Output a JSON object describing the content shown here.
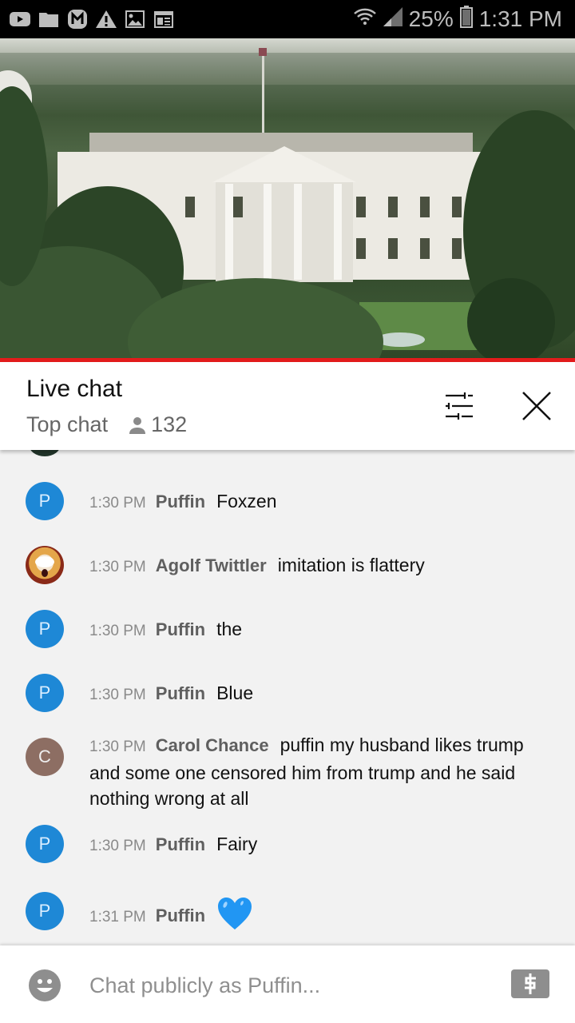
{
  "status_bar": {
    "notification_icons": [
      "youtube-icon",
      "folder-icon",
      "m-app-icon",
      "warning-icon",
      "image-icon",
      "news-icon"
    ],
    "battery_percent": "25%",
    "time": "1:31 PM",
    "wifi": "wifi-icon",
    "signal": "signal-icon"
  },
  "video": {
    "description": "White House live camera feed",
    "progress_color": "#e31b1b"
  },
  "chat_header": {
    "title": "Live chat",
    "mode": "Top chat",
    "viewer_count": "132",
    "filter_icon": "tune-icon",
    "close_icon": "close-icon"
  },
  "messages": [
    {
      "avatar_letter": "P",
      "avatar_color": "#1e88d6",
      "time": "1:30 PM",
      "author": "Puffin",
      "text": "Foxzen"
    },
    {
      "avatar_letter": "",
      "avatar_color": "#c8a05a",
      "avatar_type": "image",
      "time": "1:30 PM",
      "author": "Agolf Twittler",
      "text": "imitation is flattery"
    },
    {
      "avatar_letter": "P",
      "avatar_color": "#1e88d6",
      "time": "1:30 PM",
      "author": "Puffin",
      "text": "the"
    },
    {
      "avatar_letter": "P",
      "avatar_color": "#1e88d6",
      "time": "1:30 PM",
      "author": "Puffin",
      "text": "Blue"
    },
    {
      "avatar_letter": "C",
      "avatar_color": "#8d6e63",
      "time": "1:30 PM",
      "author": "Carol Chance",
      "text": "puffin my husband likes trump and some one censored him from trump and he said nothing wrong at all"
    },
    {
      "avatar_letter": "P",
      "avatar_color": "#1e88d6",
      "time": "1:30 PM",
      "author": "Puffin",
      "text": "Fairy"
    },
    {
      "avatar_letter": "P",
      "avatar_color": "#1e88d6",
      "time": "1:31 PM",
      "author": "Puffin",
      "text": "",
      "emoji": "blue-heart"
    }
  ],
  "input": {
    "placeholder": "Chat publicly as Puffin...",
    "value": "",
    "emoji_icon": "emoji-icon",
    "superchat_icon": "dollar-icon"
  }
}
